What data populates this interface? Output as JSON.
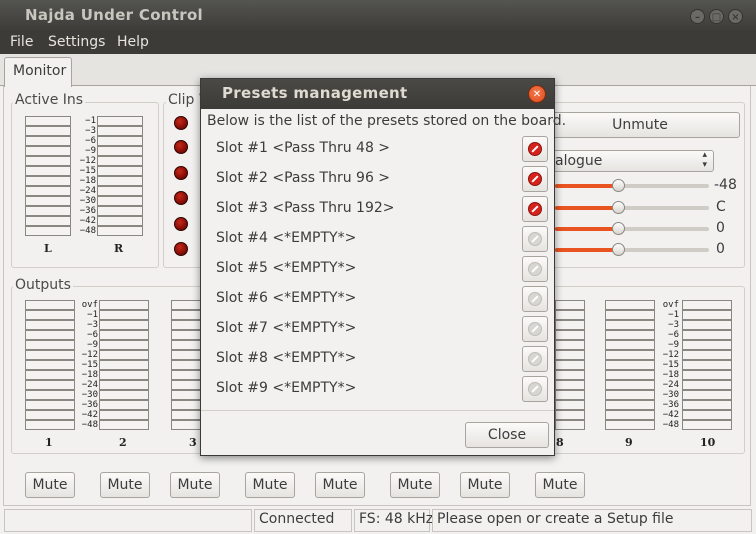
{
  "window": {
    "title": "Najda Under Control"
  },
  "menu": {
    "file": "File",
    "settings": "Settings",
    "help": "Help"
  },
  "tabs": [
    {
      "label": "Monitor"
    }
  ],
  "active_ins": {
    "label": "Active Ins",
    "scale": [
      "−1",
      "−3",
      "−6",
      "−9",
      "−12",
      "−15",
      "−18",
      "−24",
      "−30",
      "−36",
      "−42",
      "−48"
    ],
    "channels": [
      "L",
      "R"
    ]
  },
  "clip": {
    "label": "Clip W"
  },
  "right_panel": {
    "unmute_label": "Unmute",
    "select_value": "alogue",
    "slider_values": [
      "-48",
      "C",
      "0",
      "0"
    ]
  },
  "outputs": {
    "label": "Outputs",
    "scale": [
      "ovf",
      "−1",
      "−3",
      "−6",
      "−9",
      "−12",
      "−15",
      "−18",
      "−24",
      "−30",
      "−36",
      "−42",
      "−48"
    ],
    "channel_numbers": [
      "1",
      "2",
      "3",
      "8",
      "9",
      "10"
    ],
    "mute_label": "Mute"
  },
  "status": {
    "connection": "Connected",
    "fs": "FS: 48 kHz",
    "message": "Please open or create a Setup file"
  },
  "dialog": {
    "title": "Presets management",
    "intro": "Below is the list of the presets stored on the board.",
    "slots": [
      {
        "label": "Slot #1 <Pass Thru 48 >",
        "deletable": true
      },
      {
        "label": "Slot #2 <Pass Thru 96 >",
        "deletable": true
      },
      {
        "label": "Slot #3 <Pass Thru 192>",
        "deletable": true
      },
      {
        "label": "Slot #4 <*EMPTY*>",
        "deletable": false
      },
      {
        "label": "Slot #5 <*EMPTY*>",
        "deletable": false
      },
      {
        "label": "Slot #6 <*EMPTY*>",
        "deletable": false
      },
      {
        "label": "Slot #7 <*EMPTY*>",
        "deletable": false
      },
      {
        "label": "Slot #8 <*EMPTY*>",
        "deletable": false
      },
      {
        "label": "Slot #9 <*EMPTY*>",
        "deletable": false
      }
    ],
    "close_label": "Close"
  }
}
